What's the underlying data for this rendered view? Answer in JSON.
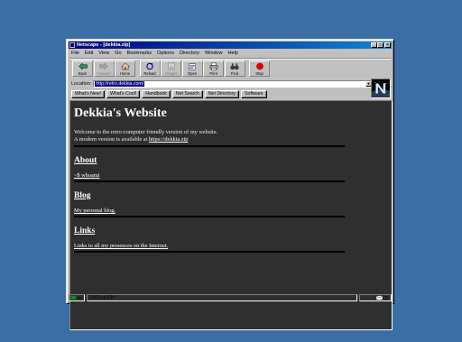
{
  "window": {
    "title": "Netscape - [dekkia.zip]",
    "buttons": {
      "minimize": "_",
      "maximize": "□",
      "close": "×"
    }
  },
  "menu": [
    "File",
    "Edit",
    "View",
    "Go",
    "Bookmarks",
    "Options",
    "Directory",
    "Window",
    "Help"
  ],
  "toolbar": {
    "back": "Back",
    "forward": "Forward",
    "home": "Home",
    "reload": "Reload",
    "images": "Images",
    "open": "Open",
    "print": "Print",
    "find": "Find",
    "stop": "Stop"
  },
  "location": {
    "label": "Location:",
    "url": "http://retro.dekkia.com/"
  },
  "directory_buttons": [
    "What's New!",
    "What's Cool!",
    "Handbook",
    "Net Search",
    "Net Directory",
    "Software"
  ],
  "page": {
    "title": "Dekkia's Website",
    "intro_line1": "Welcome to the retro-computer friendly version of my website.",
    "intro_line2_prefix": "A modern version is available at ",
    "intro_link": "https://dekkia.zip",
    "sections": [
      {
        "heading": "About",
        "link": "~$ whoami"
      },
      {
        "heading": "Blog",
        "link": "My personal blog."
      },
      {
        "heading": "Links",
        "link": "Links to all my presences on the Internet."
      }
    ]
  },
  "status": {
    "progress": "100% of 834"
  },
  "colors": {
    "accent": "#000080",
    "desktop": "#3a6ea5",
    "content_bg": "#2f2f2f"
  }
}
